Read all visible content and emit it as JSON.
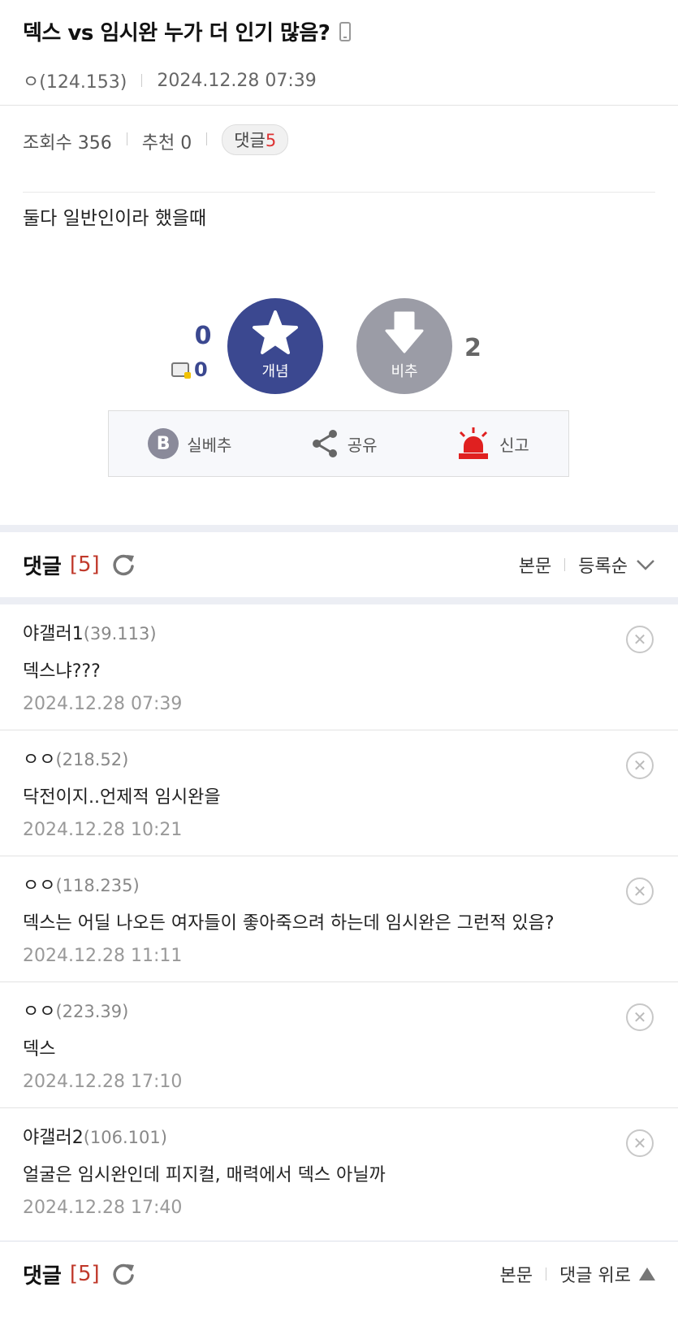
{
  "post": {
    "title": "덱스 vs 임시완 누가 더 인기 많음?",
    "author": "ㅇ(124.153)",
    "date": "2024.12.28 07:39",
    "views": "조회수 356",
    "recommend": "추천 0",
    "comment_label": "댓글",
    "comment_count": "5",
    "body": "둘다 일반인이라 했을때"
  },
  "vote": {
    "up_count": "0",
    "fix_count": "0",
    "up_label": "개념",
    "down_label": "비추",
    "down_count": "2"
  },
  "actions": {
    "best": "실베추",
    "share": "공유",
    "report": "신고"
  },
  "comments_header": {
    "title": "댓글",
    "count": "[5]",
    "body_link": "본문",
    "sort": "등록순"
  },
  "comments": [
    {
      "author": "야갤러1",
      "ip": "(39.113)",
      "text": "덱스냐???",
      "date": "2024.12.28 07:39"
    },
    {
      "author": "ㅇㅇ",
      "ip": "(218.52)",
      "text": "닥전이지..언제적 임시완을",
      "date": "2024.12.28 10:21"
    },
    {
      "author": "ㅇㅇ",
      "ip": "(118.235)",
      "text": "덱스는 어딜 나오든 여자들이 좋아죽으려 하는데 임시완은 그런적 있음?",
      "date": "2024.12.28 11:11"
    },
    {
      "author": "ㅇㅇ",
      "ip": "(223.39)",
      "text": "덱스",
      "date": "2024.12.28 17:10"
    },
    {
      "author": "야갤러2",
      "ip": "(106.101)",
      "text": "얼굴은 임시완인데 피지컬, 매력에서 덱스 아닐까",
      "date": "2024.12.28 17:40"
    }
  ],
  "footer": {
    "title": "댓글",
    "count": "[5]",
    "body_link": "본문",
    "top_link": "댓글 위로"
  },
  "colors": {
    "accent": "#3b4890",
    "down": "#9b9ca6",
    "count_red": "#c0392b",
    "report_red": "#e02020"
  }
}
